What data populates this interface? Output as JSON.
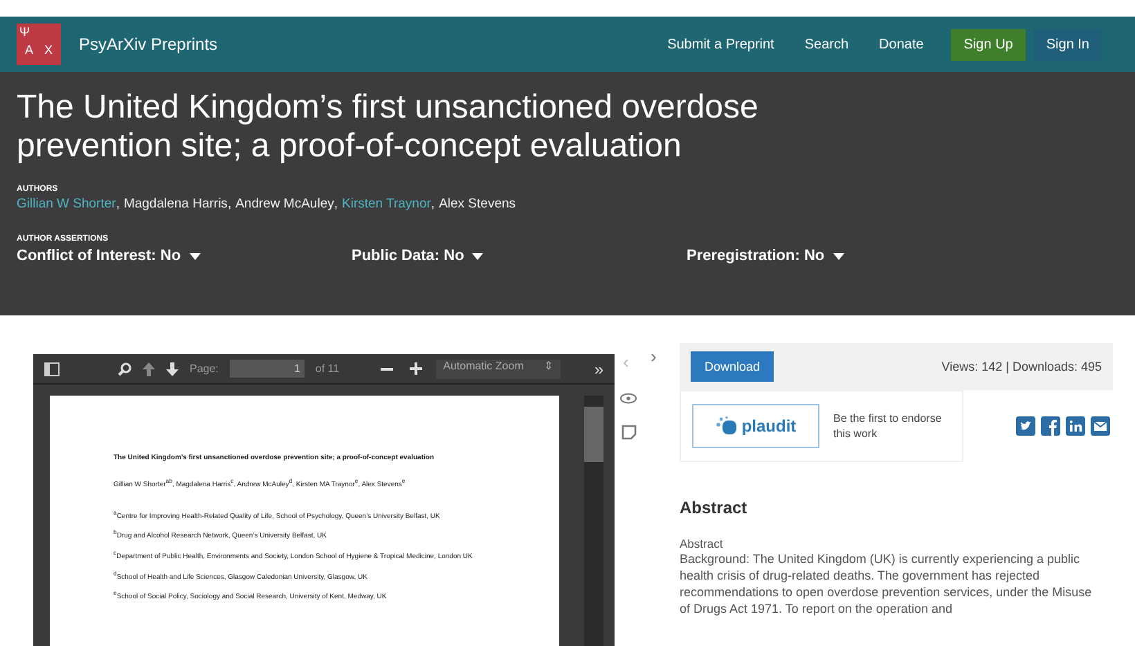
{
  "navbar": {
    "logo_letters": [
      "Ψ",
      "A",
      "X"
    ],
    "brand": "PsyArXiv Preprints",
    "links": [
      "Submit a Preprint",
      "Search",
      "Donate"
    ],
    "signup": "Sign Up",
    "signin": "Sign In"
  },
  "header": {
    "title": "The United Kingdom’s first unsanctioned overdose prevention site; a proof-of-concept evaluation",
    "authors_label": "AUTHORS",
    "author_separator": ",",
    "authors": [
      {
        "name": "Gillian W Shorter",
        "link": true
      },
      {
        "name": "Magdalena Harris",
        "link": false
      },
      {
        "name": "Andrew McAuley",
        "link": false
      },
      {
        "name": "Kirsten Traynor",
        "link": true
      },
      {
        "name": "Alex Stevens",
        "link": false
      }
    ],
    "assertions_label": "AUTHOR ASSERTIONS",
    "assertions": [
      "Conflict of Interest: No",
      "Public Data: No",
      "Preregistration: No"
    ]
  },
  "pdf_viewer": {
    "page_label": "Page:",
    "page_value": "1",
    "page_count": "of 11",
    "zoom": "Automatic Zoom",
    "zoom_caret": "⇕",
    "more": "»",
    "document": {
      "title": "The United Kingdom’s first unsanctioned overdose prevention site; a proof-of-concept evaluation",
      "authors": "Gillian W Shorter$^{ab}$, Magdalena Harris$^{c}$, Andrew McAuley$^{d}$, Kirsten MA Traynor$^{e}$, Alex Stevens$^{e}$",
      "affiliations": [
        "$^{a}$Centre for Improving Health-Related Quality of Life, School of Psychology, Queen’s University Belfast, UK",
        "$^{b}$Drug and Alcohol Research Network, Queen’s University Belfast, UK",
        "$^{c}$Department of Public Health, Environments and Society, London School of Hygiene & Tropical Medicine, London UK",
        "$^{d}$School of Health and Life Sciences, Glasgow Caledonian University, Glasgow, UK",
        "$^{e}$School of Social Policy, Sociology and Social Research, University of Kent, Medway, UK"
      ]
    }
  },
  "side_nav": {
    "prev": "‹",
    "next": "›"
  },
  "actions": {
    "download": "Download",
    "stats": "Views: 142 | Downloads: 495",
    "plaudit": "plaudit",
    "endorse": "Be the first to endorse this work"
  },
  "abstract": {
    "heading": "Abstract",
    "label": "Abstract",
    "text": "Background: The United Kingdom (UK) is currently experiencing a public health crisis of drug-related deaths. The government has rejected recommendations to open overdose prevention services, under the Misuse of Drugs Act 1971. To report on the operation and"
  }
}
